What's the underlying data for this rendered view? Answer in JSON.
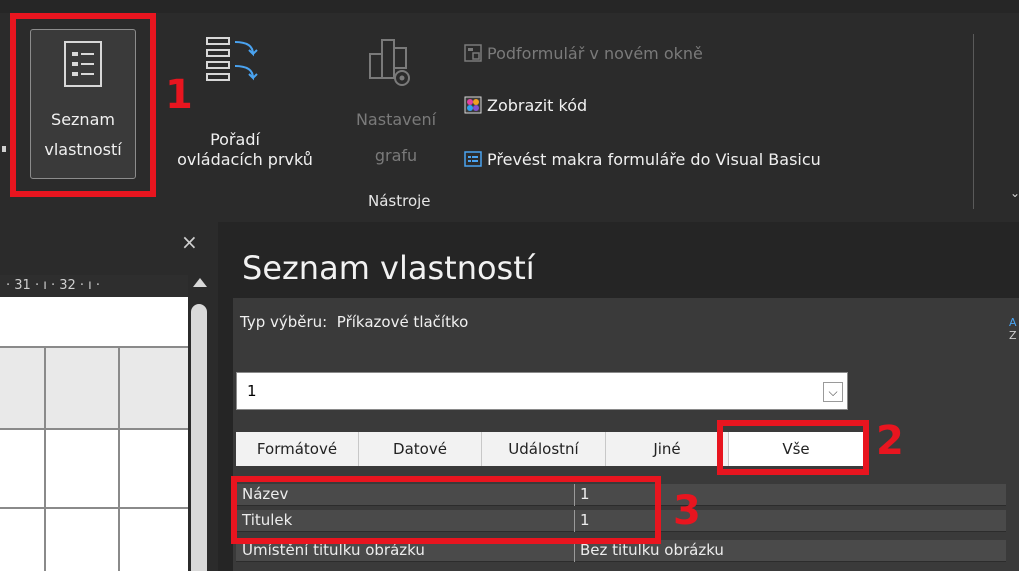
{
  "ribbon": {
    "property_sheet_label_1": "Seznam",
    "property_sheet_label_2": "vlastností",
    "tab_order_label_1": "Pořadí",
    "tab_order_label_2": "ovládacích prvků",
    "chart_settings_label_1": "Nastavení",
    "chart_settings_label_2": "grafu",
    "subform_label": "Podformulář v novém okně",
    "view_code_label": "Zobrazit kód",
    "convert_macros_label": "Převést makra formuláře do Visual Basicu",
    "group_label": "Nástroje"
  },
  "left_pane": {
    "close_glyph": "×",
    "ruler_text": "· 31 · ı · 32 · ı ·"
  },
  "property_sheet": {
    "title": "Seznam vlastností",
    "selection_type_label": "Typ výběru:",
    "selection_type_value": "Příkazové tlačítko",
    "combo_value": "1",
    "tabs": [
      {
        "label": "Formátové"
      },
      {
        "label": "Datové"
      },
      {
        "label": "Událostní"
      },
      {
        "label": "Jiné"
      },
      {
        "label": "Vše"
      }
    ],
    "rows": [
      {
        "name": "Název",
        "value": "1"
      },
      {
        "name": "Titulek",
        "value": "1"
      },
      {
        "name": "Umístění titulku obrázku",
        "value": "Bez titulku obrázku"
      }
    ]
  },
  "annotations": {
    "n1": "1",
    "n2": "2",
    "n3": "3"
  },
  "colors": {
    "annotation_red": "#e8151f",
    "ribbon_bg": "#2b2b2b"
  }
}
